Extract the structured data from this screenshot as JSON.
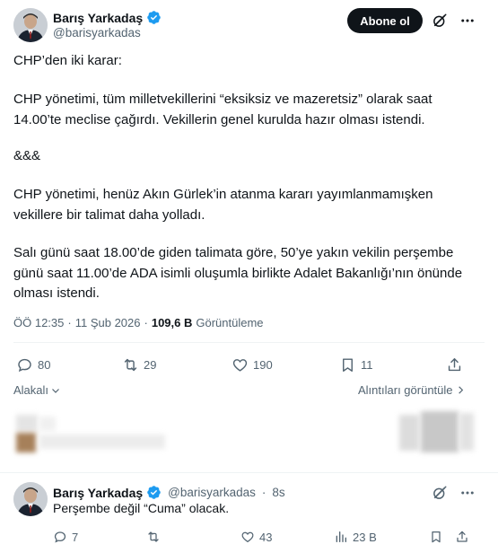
{
  "post": {
    "author_name": "Barış Yarkadaş",
    "author_handle": "@barisyarkadas",
    "follow_label": "Abone ol",
    "paragraphs": [
      "CHP’den iki karar:",
      "CHP yönetimi, tüm milletvekillerini “eksiksiz ve mazeretsiz” olarak saat 14.00’te meclise çağırdı. Vekillerin genel kurulda hazır olması istendi.",
      "&&&",
      "CHP yönetimi, henüz Akın Gürlek’in atanma kararı yayımlanmamışken vekillere bir talimat daha yolladı.",
      "Salı günü saat 18.00’de giden talimata göre, 50’ye yakın vekilin perşembe günü saat 11.00’de ADA isimli oluşumla  birlikte Adalet Bakanlığı’nın önünde olması istendi."
    ],
    "time": "ÖÖ 12:35",
    "dot": "·",
    "date": "11 Şub 2026",
    "views_count": "109,6 B",
    "views_label": "Görüntüleme",
    "actions": {
      "replies": "80",
      "reposts": "29",
      "likes": "190",
      "bookmarks": "11"
    },
    "related_label": "Alakalı",
    "quotes_label": "Alıntıları görüntüle"
  },
  "reply": {
    "author_name": "Barış Yarkadaş",
    "author_handle": "@barisyarkadas",
    "dot": "·",
    "age": "8s",
    "text": "Perşembe değil “Cuma” olacak.",
    "actions": {
      "replies": "7",
      "reposts": "",
      "likes": "43",
      "views": "23 B"
    }
  },
  "colors": {
    "verified": "#1d9bf0",
    "text": "#0f1419",
    "muted": "#536471",
    "divider": "#eff3f4"
  }
}
